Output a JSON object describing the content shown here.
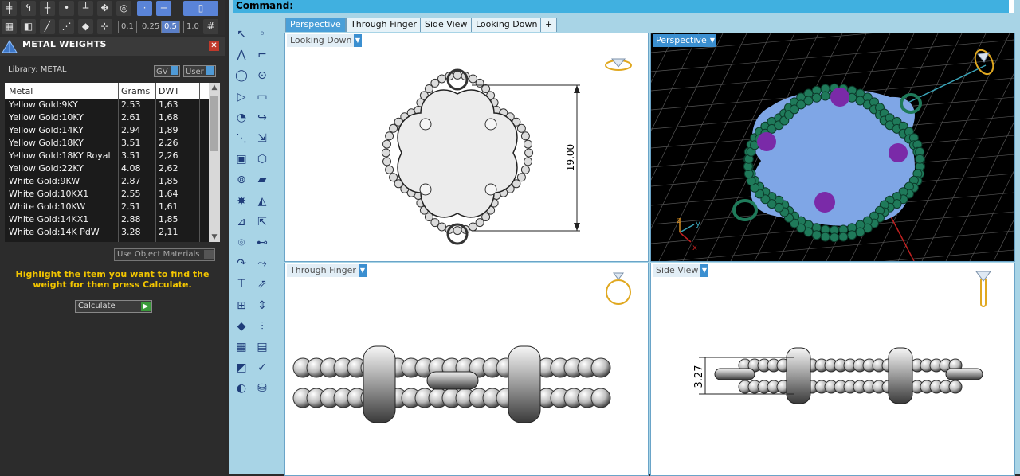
{
  "toolbar_top": {
    "icons": [
      "grid-icon",
      "curve-icon",
      "cross-icon",
      "dot-icon",
      "snap-icon",
      "orbit-icon",
      "target-icon",
      "point-snap-icon",
      "line-snap-icon",
      "window-icon"
    ],
    "snap_values": [
      "0.1",
      "0.25",
      "0.5",
      "1.0"
    ],
    "active_snap": "0.5"
  },
  "panel": {
    "title": "METAL WEIGHTS",
    "library_label": "Library: METAL",
    "gv_label": "GV",
    "user_label": "User",
    "columns": [
      "Metal",
      "Grams",
      "DWT"
    ],
    "rows": [
      {
        "metal": "Yellow Gold:9KY",
        "grams": "2.53",
        "dwt": "1,63"
      },
      {
        "metal": "Yellow Gold:10KY",
        "grams": "2.61",
        "dwt": "1,68"
      },
      {
        "metal": "Yellow Gold:14KY",
        "grams": "2.94",
        "dwt": "1,89"
      },
      {
        "metal": "Yellow Gold:18KY",
        "grams": "3.51",
        "dwt": "2,26"
      },
      {
        "metal": "Yellow Gold:18KY Royal",
        "grams": "3.51",
        "dwt": "2,26"
      },
      {
        "metal": "Yellow Gold:22KY",
        "grams": "4.08",
        "dwt": "2,62"
      },
      {
        "metal": "White Gold:9KW",
        "grams": "2.87",
        "dwt": "1,85"
      },
      {
        "metal": "White Gold:10KX1",
        "grams": "2.55",
        "dwt": "1,64"
      },
      {
        "metal": "White Gold:10KW",
        "grams": "2.51",
        "dwt": "1,61"
      },
      {
        "metal": "White Gold:14KX1",
        "grams": "2.88",
        "dwt": "1,85"
      },
      {
        "metal": "White Gold:14K PdW",
        "grams": "3.28",
        "dwt": "2,11"
      }
    ],
    "use_object_materials": "Use Object Materials",
    "hint": "Highlight the item you want to find the weight for then press Calculate.",
    "calculate": "Calculate"
  },
  "command": {
    "label": "Command:"
  },
  "tabs": [
    "Perspective",
    "Through Finger",
    "Side View",
    "Looking Down",
    "+"
  ],
  "viewports": {
    "looking_down": {
      "label": "Looking Down",
      "dimension": "19.00"
    },
    "perspective": {
      "label": "Perspective"
    },
    "through_finger": {
      "label": "Through Finger"
    },
    "side_view": {
      "label": "Side View",
      "dimension": "3.27"
    }
  },
  "tools": [
    "select-arrow-icon",
    "point-icon",
    "polyline-icon",
    "curve-point-icon",
    "circle-icon",
    "ellipse-icon",
    "polygon-icon",
    "rectangle-icon",
    "arc-icon",
    "fillet-icon",
    "control-point-icon",
    "move-icon",
    "box-icon",
    "boolean-icon",
    "cylinder-icon",
    "surface-icon",
    "gem-icon",
    "cutter-icon",
    "trim-icon",
    "dimension-icon",
    "analysis-icon",
    "nodes-icon",
    "curve-tool-icon",
    "offset-icon",
    "text-icon",
    "transform-icon",
    "array-icon",
    "scale-icon",
    "solid-box-icon",
    "rail-icon",
    "grid-array-icon",
    "settings-icon",
    "shaded-icon",
    "check-icon",
    "material-icon",
    "paint-icon"
  ],
  "colors": {
    "accent": "#4a9fd8",
    "hint": "#f2c500",
    "gem": "#7a2aa8",
    "bead": "#1f7a5a",
    "face": "#7fa6e6"
  }
}
